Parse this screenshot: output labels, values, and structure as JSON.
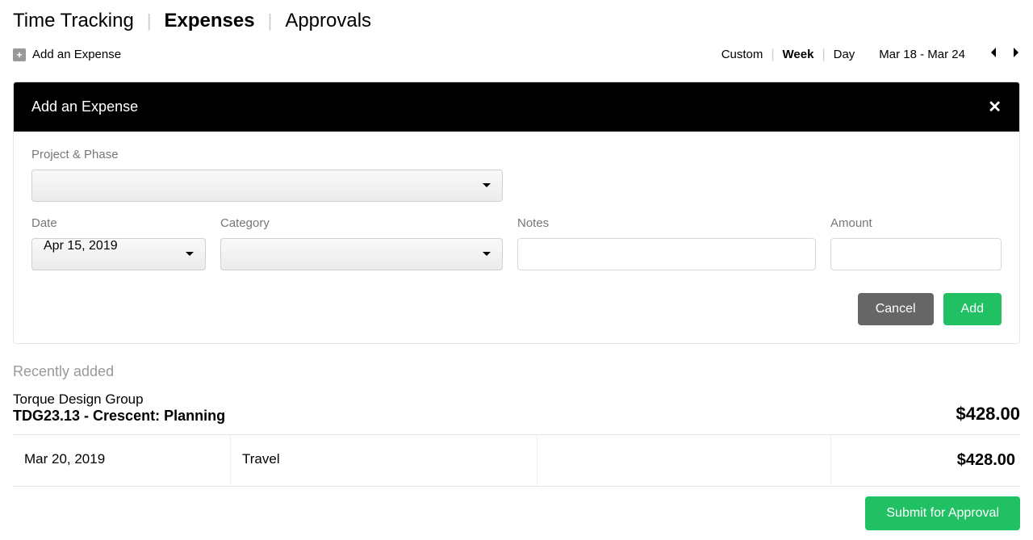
{
  "nav": {
    "tabs": [
      {
        "label": "Time Tracking",
        "active": false
      },
      {
        "label": "Expenses",
        "active": true
      },
      {
        "label": "Approvals",
        "active": false
      }
    ]
  },
  "toolbar": {
    "add_label": "Add an Expense",
    "views": [
      {
        "label": "Custom",
        "active": false
      },
      {
        "label": "Week",
        "active": true
      },
      {
        "label": "Day",
        "active": false
      }
    ],
    "date_range": "Mar 18 - Mar 24"
  },
  "panel": {
    "title": "Add an Expense",
    "labels": {
      "project_phase": "Project & Phase",
      "date": "Date",
      "category": "Category",
      "notes": "Notes",
      "amount": "Amount"
    },
    "values": {
      "project_phase": "",
      "date": "Apr 15, 2019",
      "category": "",
      "notes": "",
      "amount": ""
    },
    "buttons": {
      "cancel": "Cancel",
      "add": "Add"
    }
  },
  "recent": {
    "heading": "Recently added",
    "group": {
      "client": "Torque Design Group",
      "project": "TDG23.13 - Crescent: Planning",
      "total": "$428.00"
    },
    "rows": [
      {
        "date": "Mar 20, 2019",
        "category": "Travel",
        "amount": "$428.00"
      }
    ],
    "submit_label": "Submit for Approval"
  }
}
